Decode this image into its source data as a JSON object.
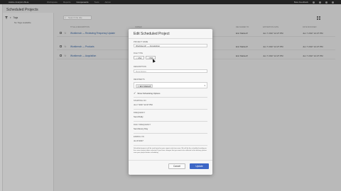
{
  "topbar": {
    "app_name": "Adobe Analytics Beta",
    "nav": [
      "Workspace",
      "Reports",
      "Components",
      "Tools",
      "Admin"
    ],
    "active_nav": "Components",
    "feedback": "Beta Feedback"
  },
  "page": {
    "title": "Scheduled Projects",
    "search_placeholder": "Search file title"
  },
  "filter": {
    "section": "Tags",
    "empty": "No Tags available"
  },
  "table": {
    "columns": [
      "Title & Description",
      "Owner",
      "Delivered To",
      "Expiration Date",
      "Date Modified"
    ],
    "rows": [
      {
        "name": "Workbench — Reviewing Frequency Update",
        "owner": "Eric Matisoff",
        "date1": "Jun 7 2017 12:27 PM",
        "date2": "Jun 7 2017 12:27 PM"
      },
      {
        "name": "Workbench — Products",
        "owner": "Eric Matisoff",
        "date1": "Jun 7 2017 12:27 PM",
        "date2": "Jun 7 2017 12:27 PM"
      },
      {
        "name": "Workbench — Acquisition",
        "owner": "Eric Matisoff",
        "date1": "Jun 7 2017 12:27 PM",
        "date2": "Jun 7 2017 12:27 PM"
      }
    ]
  },
  "modal": {
    "title": "Edit Scheduled Project",
    "project_name_label": "Project Name",
    "project_name_value": "Workbench — Acquisition",
    "file_type_label": "File Type",
    "file_types": [
      "CSV",
      "PDF"
    ],
    "description_label": "Description",
    "description_placeholder": "Description",
    "recipients_label": "Recipients",
    "recipient": "Eric Matisoff",
    "show_options_label": "Show Scheduling Options",
    "starting_on_label": "Starting On",
    "starting_on_value": "Jun 7 2017 12:27 PM",
    "frequency_label": "Frequency",
    "frequency_value": "Send Daily",
    "daily_frequency_label": "Daily Frequency",
    "daily_frequency_value": "Send Every Day",
    "ending_on_label": "Ending On",
    "ending_on_value": "Jun 8 2017",
    "note": "Scheduled projects will be sent based on your report suite time zone. We will do the scheduled sending on the current project dates selected. If you have changes that you want to be reflected in the delivery, please save your project before scheduling.",
    "cancel": "Cancel",
    "update": "Update"
  }
}
